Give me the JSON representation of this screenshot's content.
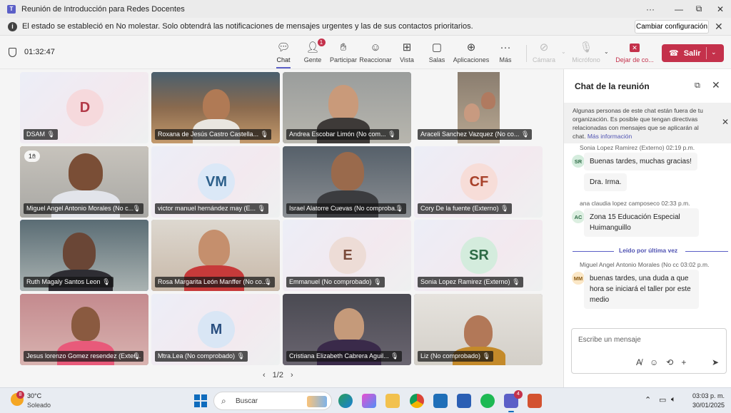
{
  "window": {
    "title": "Reunión de Introducción para Redes Docentes",
    "controls": [
      "···",
      "—",
      "⧉",
      "✕"
    ]
  },
  "notice": {
    "text": "El estado se estableció en No molestar. Solo obtendrá las notificaciones de mensajes urgentes y las de sus contactos prioritarios.",
    "button": "Cambiar configuración"
  },
  "toolbar": {
    "timer": "01:32:47",
    "buttons": [
      {
        "label": "Chat",
        "icon": "chat-icon"
      },
      {
        "label": "Gente",
        "icon": "people-icon",
        "badge": "1"
      },
      {
        "label": "Participar",
        "icon": "raise-hand-icon"
      },
      {
        "label": "Reaccionar",
        "icon": "emoji-icon"
      },
      {
        "label": "Vista",
        "icon": "grid-view-icon"
      },
      {
        "label": "Salas",
        "icon": "breakout-rooms-icon"
      },
      {
        "label": "Aplicaciones",
        "icon": "add-apps-icon"
      },
      {
        "label": "Más",
        "icon": "more-icon"
      },
      {
        "label": "Cámara",
        "icon": "camera-off-icon"
      },
      {
        "label": "Micrófono",
        "icon": "mic-off-icon"
      },
      {
        "label": "Dejar de co...",
        "icon": "stop-share-icon"
      }
    ],
    "leave": "Salir"
  },
  "participants": [
    {
      "name": "DSAM",
      "initials": "D",
      "kind": "avatar",
      "avatar_bg": "#f6d9dc",
      "avatar_fg": "#b23a48"
    },
    {
      "name": "Roxana de Jesús Castro Castella...",
      "kind": "video"
    },
    {
      "name": "Andrea Escobar Limón (No com...",
      "kind": "video"
    },
    {
      "name": "Araceli Sanchez Vazquez (No co...",
      "kind": "video"
    },
    {
      "name": "Miguel Angel Antonio Morales (No c...",
      "kind": "video",
      "raised_hand": "1"
    },
    {
      "name": "victor manuel hernández may (E...",
      "initials": "VM",
      "kind": "avatar",
      "avatar_bg": "#dbe8f7",
      "avatar_fg": "#2c5f8a"
    },
    {
      "name": "Israel Alatorre Cuevas (No comproba...",
      "kind": "video"
    },
    {
      "name": "Cory De la fuente (Externo)",
      "initials": "CF",
      "kind": "avatar",
      "avatar_bg": "#f7ddd8",
      "avatar_fg": "#a8412a"
    },
    {
      "name": "Ruth Magaly Santos Leon",
      "kind": "video"
    },
    {
      "name": "Rosa Margarita León Manffer (No co...",
      "kind": "video"
    },
    {
      "name": "Emmanuel (No comprobado)",
      "initials": "E",
      "kind": "avatar",
      "avatar_bg": "#eddcd6",
      "avatar_fg": "#7a4a3a"
    },
    {
      "name": "Sonia Lopez Ramirez (Externo)",
      "initials": "SR",
      "kind": "avatar",
      "avatar_bg": "#d4ecdd",
      "avatar_fg": "#2d6b45"
    },
    {
      "name": "Jesus lorenzo Gomez resendez (Exter...",
      "kind": "video"
    },
    {
      "name": "Mtra.Lea (No comprobado)",
      "initials": "M",
      "kind": "avatar",
      "avatar_bg": "#d9e6f5",
      "avatar_fg": "#2a4f80"
    },
    {
      "name": "Cristiana Elizabeth Cabrera Aguil...",
      "kind": "video"
    },
    {
      "name": "Liz (No comprobado)",
      "kind": "video"
    }
  ],
  "pager": {
    "prev": "‹",
    "label": "1/2",
    "next": "›"
  },
  "chat": {
    "title": "Chat de la reunión",
    "warning": "Algunas personas de este chat están fuera de tu organización. Es posible que tengan directivas relacionadas con mensajes que se aplicarán al chat.",
    "warning_link": "Más información",
    "messages": [
      {
        "meta": "Sonia Lopez Ramirez (Externo)   02:19 p.m.",
        "initials": "SR",
        "av_bg": "#d4ecdd",
        "av_fg": "#2d6b45",
        "lines": [
          "Buenas tardes, muchas gracias!",
          "Dra. Irma."
        ]
      },
      {
        "meta": "ana claudia lopez camposeco   02:33 p.m.",
        "initials": "AC",
        "av_bg": "#dcefe1",
        "av_fg": "#2d6b45",
        "lines": [
          "Zona 15 Educación Especial Huimanguillo"
        ]
      },
      {
        "meta": "Miguel Angel Antonio Morales (No cc   03:02 p.m.",
        "initials": "MM",
        "av_bg": "#fbe7c6",
        "av_fg": "#8a5a12",
        "lines": [
          "buenas tardes, una duda a que hora se iniciará el taller por este medio"
        ]
      }
    ],
    "read_marker": "Leído por última vez",
    "compose_placeholder": "Escribe un mensaje"
  },
  "taskbar": {
    "temp": "30°C",
    "condition": "Soleado",
    "weather_badge": "8",
    "search": "Buscar",
    "teams_badge": "4",
    "time": "03:03 p. m.",
    "date": "30/01/2025"
  }
}
